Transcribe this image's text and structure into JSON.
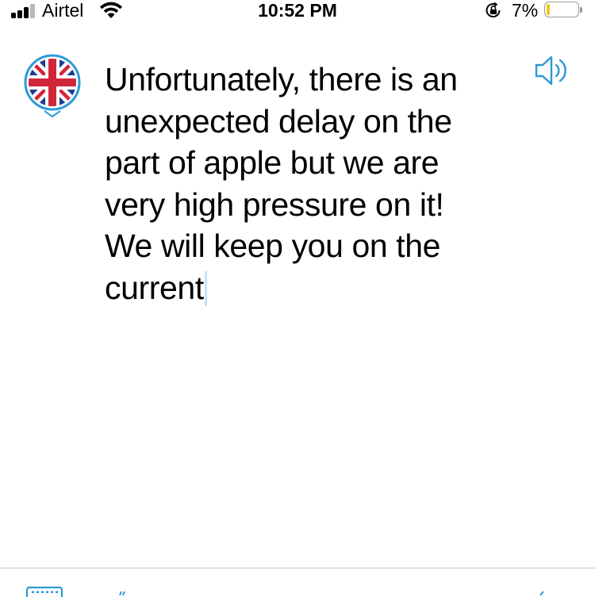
{
  "status_bar": {
    "carrier": "Airtel",
    "time": "10:52 PM",
    "battery_percent": "7%",
    "signal_bars_active": 3,
    "signal_bars_total": 4,
    "battery_level": 0.07
  },
  "translator": {
    "source_language_icon": "uk-flag-icon",
    "dropdown_icon": "chevron-down-icon",
    "speaker_icon": "speaker-icon",
    "text_lines": [
      "Unfortunately, there is an",
      "unexpected delay on the",
      "part of apple but we are",
      "very high pressure on it!",
      "We will keep you on the",
      "current"
    ]
  },
  "toolbar": {
    "keyboard_icon": "keyboard-icon"
  },
  "colors": {
    "accent": "#2b9ad8",
    "flag_blue": "#1d3e8f",
    "flag_red": "#d1263a",
    "caret": "#c6e4f5",
    "battery_low": "#f5c518"
  }
}
